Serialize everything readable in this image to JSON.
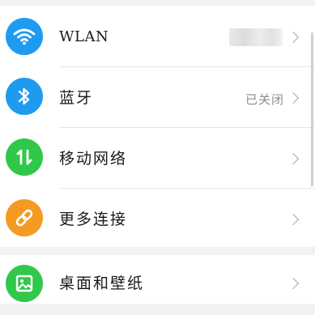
{
  "settings": {
    "items": [
      {
        "label": "WLAN",
        "value": "",
        "icon": "wifi-icon",
        "color": "#1e9bf0"
      },
      {
        "label": "蓝牙",
        "value": "已关闭",
        "icon": "bluetooth-icon",
        "color": "#1e9bf0"
      },
      {
        "label": "移动网络",
        "value": "",
        "icon": "mobile-data-icon",
        "color": "#30c84a"
      },
      {
        "label": "更多连接",
        "value": "",
        "icon": "link-icon",
        "color": "#f59a23"
      },
      {
        "label": "桌面和壁纸",
        "value": "",
        "icon": "wallpaper-icon",
        "color": "#30c84a"
      }
    ]
  }
}
